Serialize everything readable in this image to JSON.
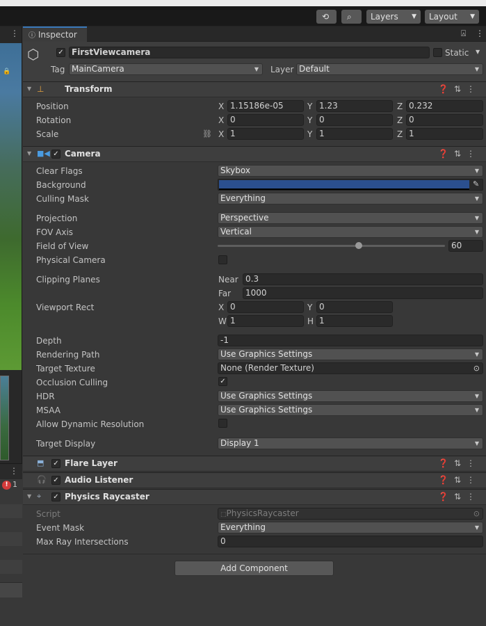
{
  "toolbar": {
    "layers_label": "Layers",
    "layout_label": "Layout"
  },
  "tabs": {
    "inspector": "Inspector"
  },
  "left": {
    "error_count": "1"
  },
  "object": {
    "name": "FirstViewcamera",
    "static_label": "Static",
    "tag_label": "Tag",
    "tag_value": "MainCamera",
    "layer_label": "Layer",
    "layer_value": "Default"
  },
  "transform": {
    "title": "Transform",
    "position_label": "Position",
    "rotation_label": "Rotation",
    "scale_label": "Scale",
    "position": {
      "x": "1.15186e-05",
      "y": "1.23",
      "z": "0.232"
    },
    "rotation": {
      "x": "0",
      "y": "0",
      "z": "0"
    },
    "scale": {
      "x": "1",
      "y": "1",
      "z": "1"
    }
  },
  "camera": {
    "title": "Camera",
    "clear_flags_label": "Clear Flags",
    "clear_flags": "Skybox",
    "background_label": "Background",
    "background_color": "#2b4f8f",
    "culling_mask_label": "Culling Mask",
    "culling_mask": "Everything",
    "projection_label": "Projection",
    "projection": "Perspective",
    "fov_axis_label": "FOV Axis",
    "fov_axis": "Vertical",
    "fov_label": "Field of View",
    "fov": "60",
    "fov_fraction": 0.62,
    "physical_label": "Physical Camera",
    "clipping_label": "Clipping Planes",
    "near_label": "Near",
    "near": "0.3",
    "far_label": "Far",
    "far": "1000",
    "viewport_label": "Viewport Rect",
    "vx": "0",
    "vy": "0",
    "vw": "1",
    "vh": "1",
    "depth_label": "Depth",
    "depth": "-1",
    "rendering_path_label": "Rendering Path",
    "rendering_path": "Use Graphics Settings",
    "target_texture_label": "Target Texture",
    "target_texture": "None (Render Texture)",
    "occlusion_label": "Occlusion Culling",
    "hdr_label": "HDR",
    "hdr": "Use Graphics Settings",
    "msaa_label": "MSAA",
    "msaa": "Use Graphics Settings",
    "dyn_res_label": "Allow Dynamic Resolution",
    "target_display_label": "Target Display",
    "target_display": "Display 1"
  },
  "flare": {
    "title": "Flare Layer"
  },
  "audio": {
    "title": "Audio Listener"
  },
  "raycaster": {
    "title": "Physics Raycaster",
    "script_label": "Script",
    "script_value": "PhysicsRaycaster",
    "event_mask_label": "Event Mask",
    "event_mask": "Everything",
    "max_ray_label": "Max Ray Intersections",
    "max_ray": "0"
  },
  "add_component_label": "Add Component",
  "axes": {
    "x": "X",
    "y": "Y",
    "z": "Z",
    "w": "W",
    "h": "H"
  }
}
